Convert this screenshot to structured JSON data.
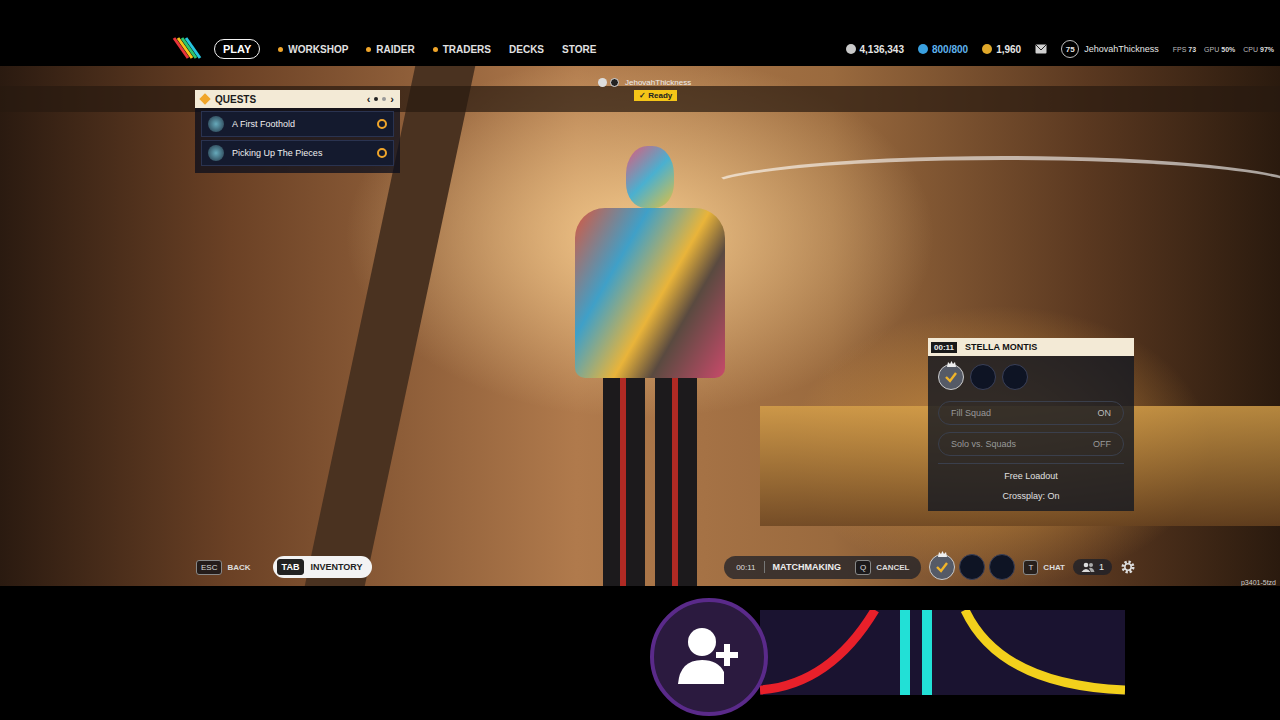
{
  "nav": {
    "items": [
      {
        "label": "PLAY",
        "selected": true,
        "alert": false
      },
      {
        "label": "WORKSHOP",
        "selected": false,
        "alert": true
      },
      {
        "label": "RAIDER",
        "selected": false,
        "alert": true
      },
      {
        "label": "TRADERS",
        "selected": false,
        "alert": true
      },
      {
        "label": "DECKS",
        "selected": false,
        "alert": false
      },
      {
        "label": "STORE",
        "selected": false,
        "alert": false
      }
    ]
  },
  "currencies": [
    {
      "kind": "coins",
      "value": "4,136,343",
      "color": "#c9c9c9"
    },
    {
      "kind": "tokens",
      "value": "800/800",
      "color": "#3aa0e0"
    },
    {
      "kind": "credits",
      "value": "1,960",
      "color": "#e0a82a"
    }
  ],
  "account": {
    "level": "75",
    "name": "JehovahThickness"
  },
  "performance": [
    {
      "label": "FPS",
      "value": "73"
    },
    {
      "label": "GPU",
      "value": "50%"
    },
    {
      "label": "CPU",
      "value": "97%"
    }
  ],
  "quests": {
    "title": "QUESTS",
    "prev": "‹",
    "next": "›",
    "pages": [
      {
        "selected": true
      },
      {
        "selected": false
      }
    ],
    "items": [
      {
        "title": "A First Foothold"
      },
      {
        "title": "Picking Up The Pieces"
      }
    ]
  },
  "player_tag": {
    "name": "JehovahThickness",
    "check": "✓",
    "status": "Ready",
    "ready": true
  },
  "matchmaking_panel": {
    "timer": "00:11",
    "map": "STELLA MONTIS",
    "slots": [
      {
        "filled": true,
        "leader": true
      },
      {
        "filled": false,
        "leader": false
      },
      {
        "filled": false,
        "leader": false
      }
    ],
    "options": [
      {
        "label": "Fill Squad",
        "value": "ON",
        "on": true
      },
      {
        "label": "Solo vs. Squads",
        "value": "OFF",
        "on": false
      }
    ],
    "info": [
      "Free Loadout",
      "Crossplay: On"
    ]
  },
  "bottom_bar": {
    "back": {
      "key": "ESC",
      "label": "BACK"
    },
    "inventory": {
      "key": "TAB",
      "label": "INVENTORY"
    },
    "matchmaking": {
      "timer": "00:11",
      "label": "MATCHMAKING",
      "key": "Q",
      "action": "CANCEL"
    },
    "slots": [
      {
        "filled": true,
        "leader": true
      },
      {
        "filled": false,
        "leader": false
      },
      {
        "filled": false,
        "leader": false
      }
    ],
    "chat": {
      "key": "T",
      "label": "CHAT"
    },
    "party_count": "1"
  },
  "build_id": "p3401-5tzd"
}
